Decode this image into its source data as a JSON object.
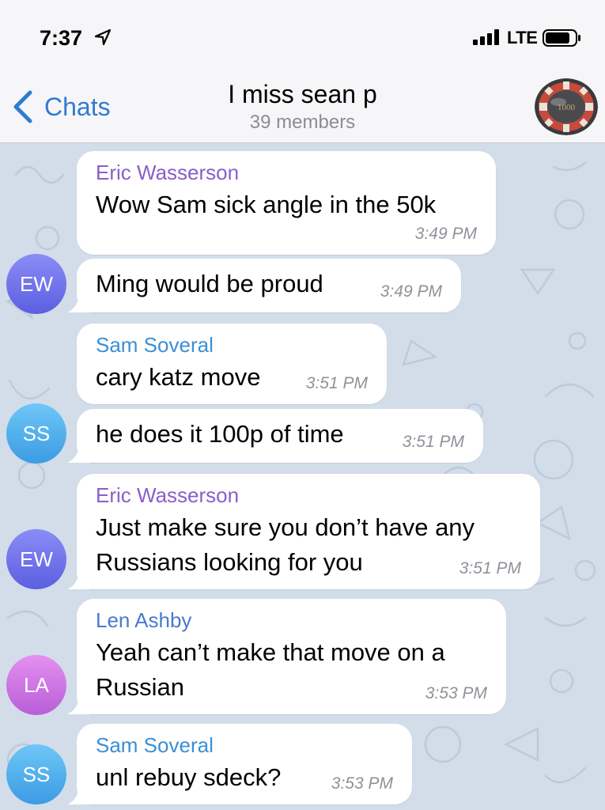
{
  "status_bar": {
    "time": "7:37",
    "network": "LTE"
  },
  "header": {
    "back_label": "Chats",
    "title": "I miss sean p",
    "subtitle": "39 members",
    "avatar_text": "1000"
  },
  "colors": {
    "accent": "#2f7bd1",
    "eric": "#8a5ec9",
    "sam": "#3b8fd6",
    "len": "#4a79cf"
  },
  "messages": [
    {
      "sender": "Eric Wasserson",
      "text": "Wow Sam sick angle in the 50k",
      "time": "3:49 PM"
    },
    {
      "avatar": "EW",
      "text": "Ming would be proud",
      "time": "3:49 PM"
    },
    {
      "sender": "Sam Soveral",
      "text": "cary katz move",
      "time": "3:51 PM"
    },
    {
      "avatar": "SS",
      "text": "he does it 100p of time",
      "time": "3:51 PM"
    },
    {
      "sender": "Eric Wasserson",
      "avatar": "EW",
      "text_line1": "Just make sure you don’t have any",
      "text_line2": "Russians looking for you",
      "time": "3:51 PM"
    },
    {
      "sender": "Len Ashby",
      "avatar": "LA",
      "text_line1": "Yeah can’t make that move on a",
      "text_line2": "Russian",
      "time": "3:53 PM"
    },
    {
      "sender": "Sam Soveral",
      "avatar": "SS",
      "text": "unl rebuy sdeck?",
      "time": "3:53 PM"
    }
  ]
}
